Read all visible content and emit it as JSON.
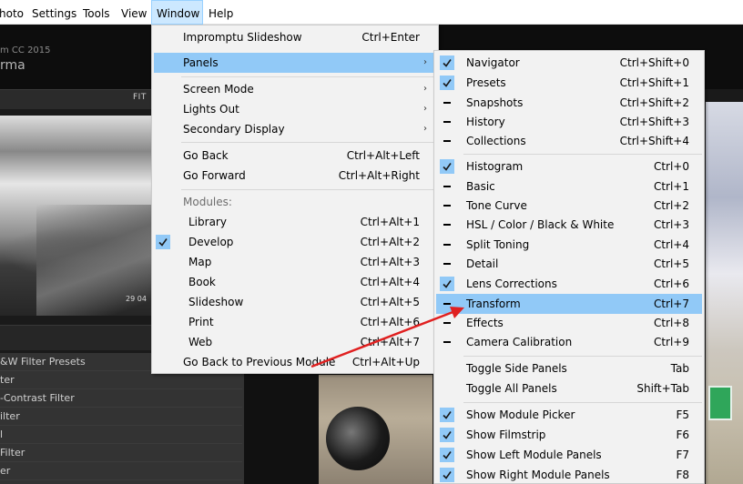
{
  "menubar": {
    "items": [
      {
        "label": "hoto",
        "active": false
      },
      {
        "label": "Settings",
        "active": false
      },
      {
        "label": "Tools",
        "active": false
      },
      {
        "label": "View",
        "active": false
      },
      {
        "label": "Window",
        "active": true
      },
      {
        "label": "Help",
        "active": false
      }
    ]
  },
  "background_app": {
    "version": "m CC 2015",
    "name": "rma",
    "fit_label": "FIT",
    "date": "29 04",
    "preset_items": [
      "&W Filter Presets",
      "ter",
      "-Contrast Filter",
      "ilter",
      "l",
      " Filter",
      "er"
    ]
  },
  "window_menu": {
    "items": [
      {
        "label": "Impromptu Slideshow",
        "shortcut": "Ctrl+Enter"
      },
      {
        "label": "Panels",
        "submenu": true,
        "highlighted": true
      },
      {
        "label": "Screen Mode",
        "submenu": true
      },
      {
        "label": "Lights Out",
        "submenu": true
      },
      {
        "label": "Secondary Display",
        "submenu": true
      },
      {
        "label": "Go Back",
        "shortcut": "Ctrl+Alt+Left"
      },
      {
        "label": "Go Forward",
        "shortcut": "Ctrl+Alt+Right"
      },
      {
        "label": "Modules:",
        "heading": true
      },
      {
        "label": "Library",
        "shortcut": "Ctrl+Alt+1"
      },
      {
        "label": "Develop",
        "shortcut": "Ctrl+Alt+2",
        "checked": true
      },
      {
        "label": "Map",
        "shortcut": "Ctrl+Alt+3"
      },
      {
        "label": "Book",
        "shortcut": "Ctrl+Alt+4"
      },
      {
        "label": "Slideshow",
        "shortcut": "Ctrl+Alt+5"
      },
      {
        "label": "Print",
        "shortcut": "Ctrl+Alt+6"
      },
      {
        "label": "Web",
        "shortcut": "Ctrl+Alt+7"
      },
      {
        "label": "Go Back to Previous Module",
        "shortcut": "Ctrl+Alt+Up"
      }
    ]
  },
  "panels_menu": {
    "items": [
      {
        "label": "Navigator",
        "shortcut": "Ctrl+Shift+0",
        "state": "checked"
      },
      {
        "label": "Presets",
        "shortcut": "Ctrl+Shift+1",
        "state": "checked"
      },
      {
        "label": "Snapshots",
        "shortcut": "Ctrl+Shift+2",
        "state": "dash"
      },
      {
        "label": "History",
        "shortcut": "Ctrl+Shift+3",
        "state": "dash"
      },
      {
        "label": "Collections",
        "shortcut": "Ctrl+Shift+4",
        "state": "dash"
      },
      {
        "label": "Histogram",
        "shortcut": "Ctrl+0",
        "state": "checked"
      },
      {
        "label": "Basic",
        "shortcut": "Ctrl+1",
        "state": "dash"
      },
      {
        "label": "Tone Curve",
        "shortcut": "Ctrl+2",
        "state": "dash"
      },
      {
        "label": "HSL / Color / Black & White",
        "shortcut": "Ctrl+3",
        "state": "dash"
      },
      {
        "label": "Split Toning",
        "shortcut": "Ctrl+4",
        "state": "dash"
      },
      {
        "label": "Detail",
        "shortcut": "Ctrl+5",
        "state": "dash"
      },
      {
        "label": "Lens Corrections",
        "shortcut": "Ctrl+6",
        "state": "checked"
      },
      {
        "label": "Transform",
        "shortcut": "Ctrl+7",
        "state": "dash",
        "highlighted": true
      },
      {
        "label": "Effects",
        "shortcut": "Ctrl+8",
        "state": "dash"
      },
      {
        "label": "Camera Calibration",
        "shortcut": "Ctrl+9",
        "state": "dash"
      },
      {
        "label": "Toggle Side Panels",
        "shortcut": "Tab",
        "state": "none"
      },
      {
        "label": "Toggle All Panels",
        "shortcut": "Shift+Tab",
        "state": "none"
      },
      {
        "label": "Show Module Picker",
        "shortcut": "F5",
        "state": "checked"
      },
      {
        "label": "Show Filmstrip",
        "shortcut": "F6",
        "state": "checked"
      },
      {
        "label": "Show Left Module Panels",
        "shortcut": "F7",
        "state": "checked"
      },
      {
        "label": "Show Right Module Panels",
        "shortcut": "F8",
        "state": "checked"
      }
    ]
  },
  "colors": {
    "highlight": "#91c9f7",
    "menubar_active": "#cce8ff",
    "annotation_arrow": "#e02020"
  }
}
